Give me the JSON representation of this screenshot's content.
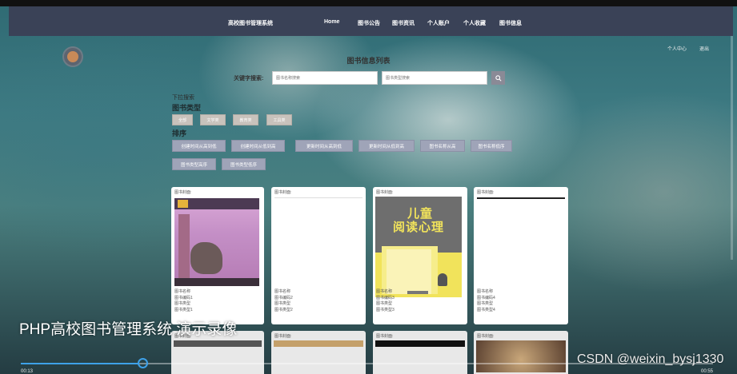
{
  "app": {
    "title": "高校图书管理系统"
  },
  "nav": {
    "items": [
      {
        "label": "Home"
      },
      {
        "label": "图书公告"
      },
      {
        "label": "图书资讯"
      },
      {
        "label": "个人账户"
      },
      {
        "label": "个人收藏"
      },
      {
        "label": "图书信息"
      }
    ]
  },
  "user": {
    "center": "个人中心",
    "logout": "退出"
  },
  "page": {
    "title": "图书信息列表"
  },
  "search": {
    "label": "关键字搜索:",
    "name_placeholder": "图书名称搜索",
    "type_placeholder": "图书类型搜索"
  },
  "filters": {
    "dropdown_label": "下拉搜索",
    "type_heading": "图书类型",
    "types": [
      "全部",
      "文学类",
      "教育类",
      "工具类"
    ],
    "sort_heading": "排序",
    "sort_options": [
      "创建时间从高到低",
      "创建时间从低到高",
      "更新时间从高到低",
      "更新时间从低到高",
      "图书名称从高",
      "图书名称低序",
      "图书类型高序",
      "图书类型低序"
    ]
  },
  "cards": [
    {
      "header": "图书封面:",
      "name": "图书名称",
      "code": "图书编码1",
      "type": "图书类型",
      "type2": "图书类型1"
    },
    {
      "header": "图书封面:",
      "name": "图书名称",
      "code": "图书编码2",
      "type": "图书类型",
      "type2": "图书类型2"
    },
    {
      "header": "图书封面:",
      "cover_line1": "儿童",
      "cover_line2": "阅读心理",
      "name": "图书名称",
      "code": "图书编码3",
      "type": "图书类型",
      "type2": "图书类型3"
    },
    {
      "header": "图书封面:",
      "name": "图书名称",
      "code": "图书编码4",
      "type": "图书类型",
      "type2": "图书类型4"
    }
  ],
  "second_row": [
    {
      "header": "图书封面:"
    },
    {
      "header": "图书封面:"
    },
    {
      "header": "图书封面:"
    },
    {
      "header": "图书封面:"
    }
  ],
  "video": {
    "overlay_title": "PHP高校图书管理系统 演示录像",
    "watermark": "CSDN @weixin_bysj1330",
    "progress": 0.17,
    "current_time": "00:13",
    "total_time": "00:55",
    "accent": "#3ea1e8"
  }
}
